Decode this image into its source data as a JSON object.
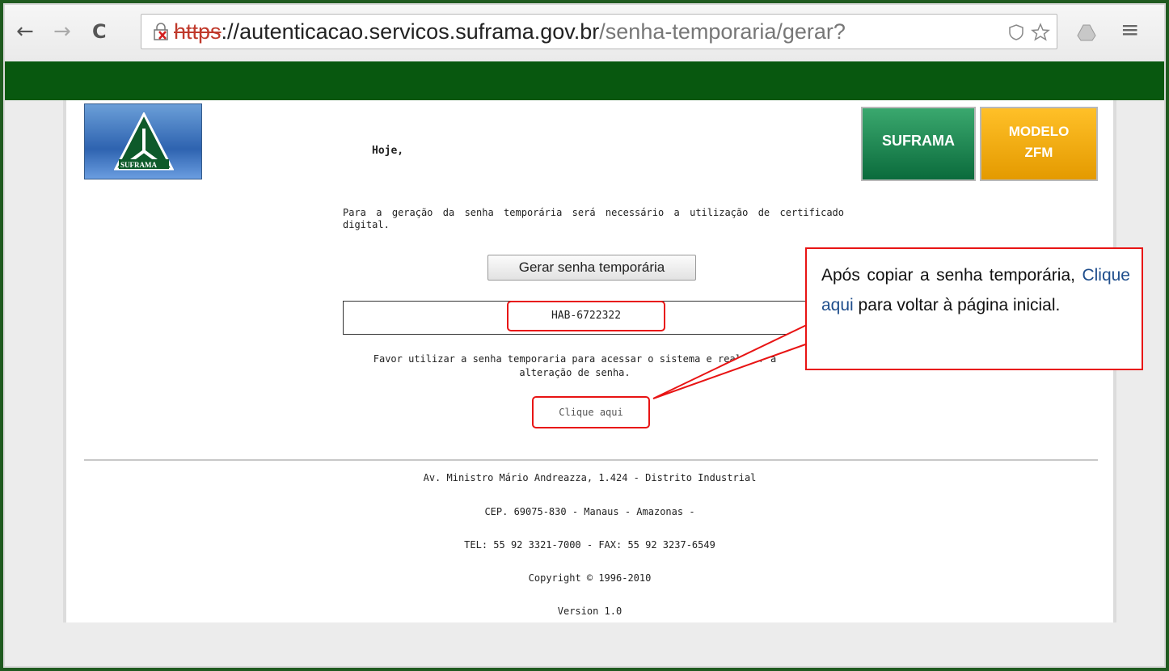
{
  "browser": {
    "url_scheme": "https",
    "url_separator": "://",
    "url_host": "autenticacao.servicos.suframa.gov.br",
    "url_path": "/senha-temporaria/gerar?",
    "back_icon": "←",
    "forward_icon": "→",
    "reload_icon": "C",
    "menu_icon": "≡"
  },
  "header": {
    "logo_text": "SUFRAMA",
    "hoje": "Hoje,",
    "btn_suframa": "SUFRAMA",
    "btn_modelo_line1": "MODELO",
    "btn_modelo_line2": "ZFM"
  },
  "main": {
    "instruction": "Para a geração da senha temporária será necessário a utilização de certificado digital.",
    "gerar_button": "Gerar senha temporária",
    "senha_value": "HAB-6722322",
    "favor_line1": "Favor utilizar a senha temporaria para acessar o sistema e realizar a",
    "favor_line2": "alteração de senha.",
    "clique_link": "Clique aqui"
  },
  "footer": {
    "address": "Av. Ministro Mário Andreazza, 1.424 - Distrito Industrial",
    "cep": "CEP. 69075-830 - Manaus - Amazonas -",
    "tel": "TEL: 55 92 3321-7000 - FAX: 55 92 3237-6549",
    "copyright": "Copyright © 1996-2010",
    "version": "Version 1.0"
  },
  "callout": {
    "part1": "Após copiar a senha temporária,",
    "link": "Clique aqui",
    "part2": "para voltar à página inicial."
  },
  "colors": {
    "highlight_red": "#e81414",
    "green_bar": "#08580f",
    "suframa_green": "#0b6b3c",
    "modelo_orange": "#e49a00"
  }
}
